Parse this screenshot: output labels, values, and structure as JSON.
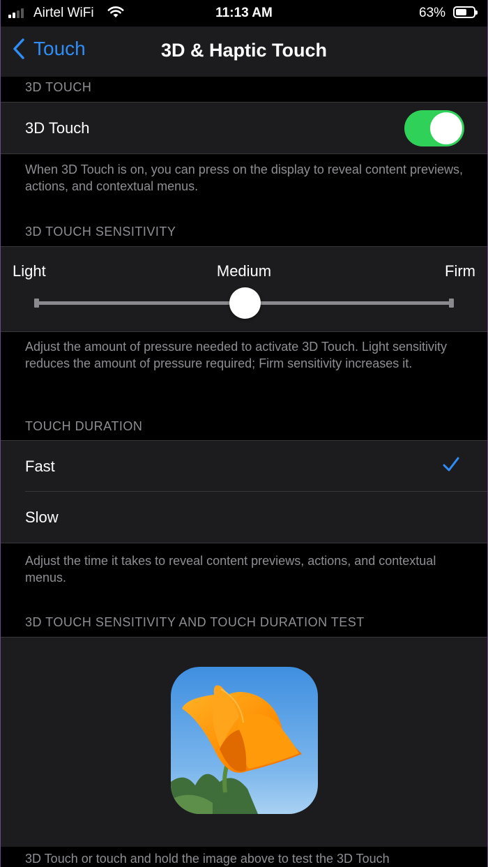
{
  "status_bar": {
    "carrier": "Airtel WiFi",
    "time": "11:13 AM",
    "battery_percent": "63%",
    "battery_level": 0.63,
    "signal_bars": 2,
    "icons": [
      "signal-icon",
      "wifi-icon",
      "battery-icon"
    ]
  },
  "nav": {
    "back_label": "Touch",
    "title": "3D & Haptic Touch"
  },
  "sections": {
    "touch_3d": {
      "header": "3D TOUCH",
      "row_label": "3D Touch",
      "toggle_on": true,
      "footer": "When 3D Touch is on, you can press on the display to reveal content previews, actions, and contextual menus."
    },
    "sensitivity": {
      "header": "3D TOUCH SENSITIVITY",
      "labels": [
        "Light",
        "Medium",
        "Firm"
      ],
      "selected": "Medium",
      "slider_value": 0.5,
      "footer": "Adjust the amount of pressure needed to activate 3D Touch. Light sensitivity reduces the amount of pressure required; Firm sensitivity increases it."
    },
    "duration": {
      "header": "TOUCH DURATION",
      "options": [
        {
          "label": "Fast",
          "selected": true
        },
        {
          "label": "Slow",
          "selected": false
        }
      ],
      "footer": "Adjust the time it takes to reveal content previews, actions, and contextual menus."
    },
    "test": {
      "header": "3D TOUCH SENSITIVITY AND TOUCH DURATION TEST",
      "footer": "3D Touch or touch and hold the image above to test the 3D Touch"
    }
  },
  "colors": {
    "accent": "#2f8df5",
    "toggle_on": "#30d158",
    "group_bg": "#1c1c1e",
    "secondary_text": "#8e8e93"
  }
}
